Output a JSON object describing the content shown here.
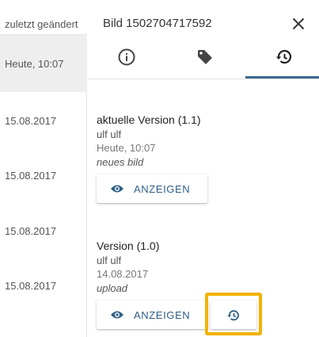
{
  "list": {
    "column_header": "zuletzt geändert",
    "selected_date": "Heute, 10:07",
    "rows": [
      "15.08.2017",
      "15.08.2017",
      "15.08.2017",
      "15.08.2017"
    ]
  },
  "panel": {
    "title": "Bild 1502704717592",
    "close_icon": "close-icon",
    "tabs": [
      {
        "icon": "info-icon",
        "active": false
      },
      {
        "icon": "tag-icon",
        "active": false
      },
      {
        "icon": "history-icon",
        "active": true
      }
    ]
  },
  "versions": [
    {
      "title": "aktuelle Version (1.1)",
      "author": "ulf ulf",
      "date": "Heute, 10:07",
      "note": "neues bild",
      "show_label": "ANZEIGEN",
      "has_restore": false
    },
    {
      "title": "Version (1.0)",
      "author": "ulf ulf",
      "date": "14.08.2017",
      "note": "upload",
      "show_label": "ANZEIGEN",
      "has_restore": true
    }
  ],
  "colors": {
    "accent": "#2f5f86",
    "tab_indicator": "#3d6b8f",
    "highlight": "#f2b200",
    "selected_row": "#eeeeee"
  }
}
